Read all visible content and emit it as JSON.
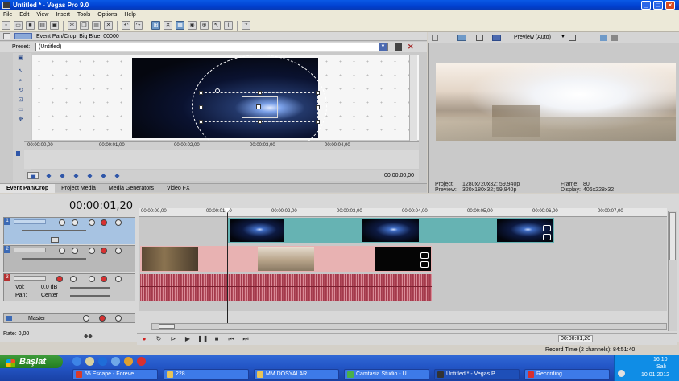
{
  "window": {
    "title": "Untitled * - Vegas Pro 9.0",
    "controls": [
      "_",
      "□",
      "×"
    ]
  },
  "menu": [
    "File",
    "Edit",
    "View",
    "Insert",
    "Tools",
    "Options",
    "Help"
  ],
  "pan_crop": {
    "header": "Event Pan/Crop: Big Blue_00000",
    "preset_label": "Preset:",
    "preset_value": "(Untitled)",
    "ruler": [
      "00:00:00,00",
      "00:00:01,00",
      "00:00:02,00",
      "00:00:03,00",
      "00:00:04,00"
    ],
    "time": "00:00:00,00"
  },
  "bottom_tabs": [
    "Event Pan/Crop",
    "Project Media",
    "Media Generators",
    "Video FX"
  ],
  "preview": {
    "mode": "Preview (Auto)",
    "project_label": "Project:",
    "project": "1280x720x32; 59,940p",
    "preview_label": "Preview:",
    "preview": "320x180x32; 59,940p",
    "frame_label": "Frame:",
    "frame": "80",
    "display_label": "Display:",
    "display": "406x228x32"
  },
  "timeline": {
    "cursor_time": "00:00:01,20",
    "ruler": [
      "00:00:00,00",
      "00:00:01,00",
      "00:00:02,00",
      "00:00:03,00",
      "00:00:04,00",
      "00:00:05,00",
      "00:00:06,00",
      "00:00:07,00"
    ],
    "tracks": [
      {
        "number": "1"
      },
      {
        "number": "2"
      },
      {
        "number": "3",
        "vol_label": "Vol:",
        "vol": "0,0 dB",
        "pan_label": "Pan:",
        "pan": "Center"
      }
    ],
    "master_label": "Master",
    "rate_label": "Rate: 0,00",
    "end_time": "00:00:01,20",
    "record_time": "Record Time (2 channels): 84:51:40"
  },
  "taskbar": {
    "start": "Başlat",
    "tasks": [
      "55 Escape - Foreve...",
      "228",
      "MM DOSYALAR",
      "Camtasia Studio - U...",
      "Untitled * - Vegas P...",
      "Recording..."
    ],
    "clock_time": "16:10",
    "clock_day": "Salı",
    "clock_date": "10.01.2012"
  }
}
